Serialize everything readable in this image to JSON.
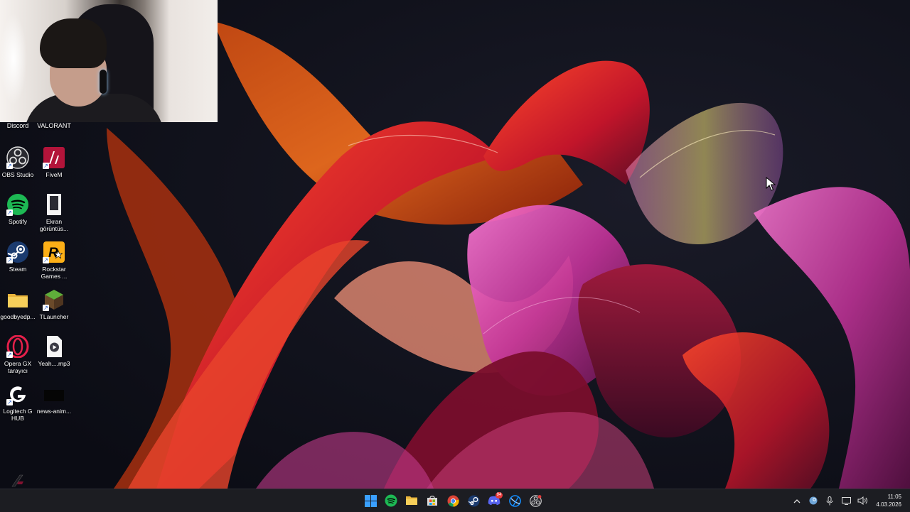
{
  "desktop": {
    "top_labels": [
      "Discord",
      "VALORANT"
    ],
    "icons": [
      {
        "label": "OBS Studio",
        "icon": "obs-icon"
      },
      {
        "label": "FiveM",
        "icon": "fivem-icon"
      },
      {
        "label": "Spotify",
        "icon": "spotify-icon"
      },
      {
        "label": "Ekran\ngörüntüs...",
        "icon": "screenshot-file-icon"
      },
      {
        "label": "Steam",
        "icon": "steam-icon"
      },
      {
        "label": "Rockstar\nGames ...",
        "icon": "rockstar-icon"
      },
      {
        "label": "goodbyedp...",
        "icon": "folder-icon"
      },
      {
        "label": "TLauncher",
        "icon": "tlauncher-icon"
      },
      {
        "label": "Opera GX\ntarayıcı",
        "icon": "opera-gx-icon"
      },
      {
        "label": "Yeah....mp3",
        "icon": "audio-file-icon"
      },
      {
        "label": "Logitech G\nHUB",
        "icon": "logitech-g-hub-icon"
      },
      {
        "label": "news-anim...",
        "icon": "video-file-icon"
      }
    ]
  },
  "taskbar": {
    "apps": [
      {
        "name": "start",
        "icon": "windows-start-icon"
      },
      {
        "name": "spotify",
        "icon": "spotify-icon"
      },
      {
        "name": "file-explorer",
        "icon": "folder-icon"
      },
      {
        "name": "microsoft-store",
        "icon": "store-icon"
      },
      {
        "name": "chrome",
        "icon": "chrome-icon"
      },
      {
        "name": "steam",
        "icon": "steam-icon"
      },
      {
        "name": "discord",
        "icon": "discord-icon",
        "badge": "94"
      },
      {
        "name": "battle-net",
        "icon": "battlenet-icon"
      },
      {
        "name": "obs",
        "icon": "obs-icon"
      }
    ],
    "clock": {
      "time": "11:05",
      "date": "4.03.2026"
    }
  },
  "colors": {
    "taskbar_bg": "#1c1d22",
    "spotify": "#1db954",
    "discord": "#5865f2",
    "windows_blue": "#3aa0ff"
  }
}
